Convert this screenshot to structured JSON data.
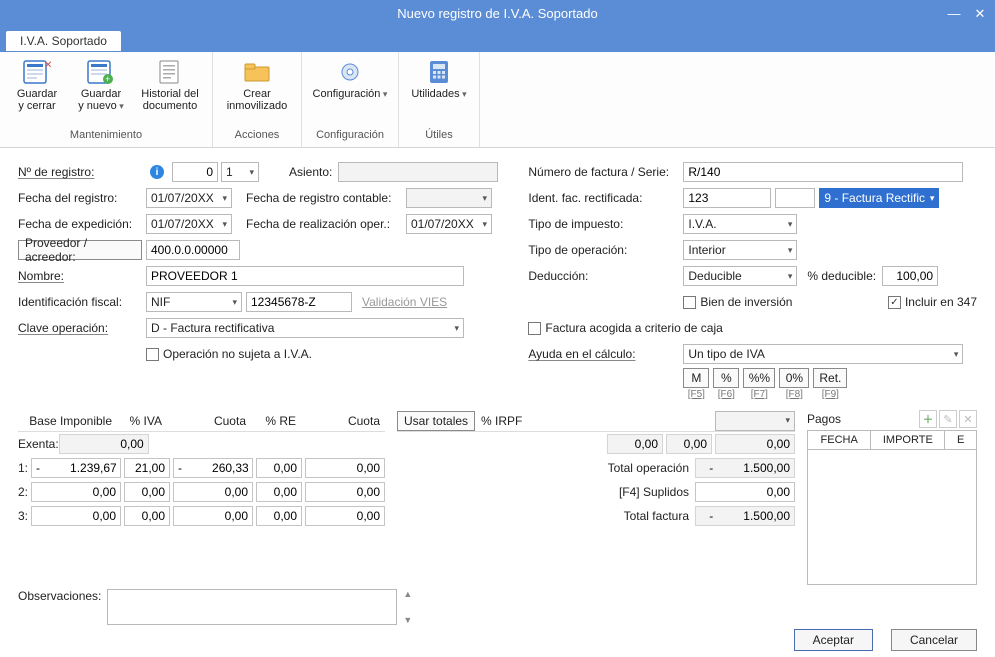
{
  "window": {
    "title": "Nuevo registro de I.V.A. Soportado"
  },
  "tab": {
    "active": "I.V.A. Soportado"
  },
  "ribbon": {
    "groups": {
      "mantenimiento": {
        "label": "Mantenimiento",
        "guardar_cerrar": "Guardar\ny cerrar",
        "guardar_nuevo": "Guardar\ny nuevo",
        "historial": "Historial del\ndocumento"
      },
      "acciones": {
        "label": "Acciones",
        "crear_inmovilizado": "Crear\ninmovilizado"
      },
      "configuracion": {
        "label": "Configuración",
        "configuracion": "Configuración"
      },
      "utiles": {
        "label": "Útiles",
        "utilidades": "Utilidades"
      }
    }
  },
  "left": {
    "n_registro_lbl": "Nº de registro:",
    "n_registro": "0",
    "n_registro_ser": "1",
    "fecha_registro_lbl": "Fecha del registro:",
    "fecha_registro": "01/07/20XX",
    "fecha_expedicion_lbl": "Fecha de expedición:",
    "fecha_expedicion": "01/07/20XX",
    "proveedor_lbl": "Proveedor / acreedor:",
    "proveedor": "400.0.0.00000",
    "nombre_lbl": "Nombre:",
    "nombre": "PROVEEDOR 1",
    "ident_fiscal_lbl": "Identificación fiscal:",
    "ident_tipo": "NIF",
    "ident_valor": "12345678-Z",
    "validacion_vies": "Validación VIES",
    "clave_op_lbl": "Clave operación:",
    "clave_op": "D - Factura rectificativa",
    "no_sujeta_iva": "Operación no sujeta a I.V.A.",
    "asiento_lbl": "Asiento:",
    "fecha_reg_contable_lbl": "Fecha de registro contable:",
    "fecha_realizacion_lbl": "Fecha de realización oper.:",
    "fecha_realizacion": "01/07/20XX"
  },
  "right": {
    "num_factura_lbl": "Número de factura / Serie:",
    "num_factura": "R/140",
    "ident_rect_lbl": "Ident. fac. rectificada:",
    "ident_rect": "123",
    "ident_rect_tipo": "9 - Factura Rectific",
    "tipo_impuesto_lbl": "Tipo de impuesto:",
    "tipo_impuesto": "I.V.A.",
    "tipo_operacion_lbl": "Tipo de operación:",
    "tipo_operacion": "Interior",
    "deduccion_lbl": "Deducción:",
    "deduccion": "Deducible",
    "pct_deducible_lbl": "% deducible:",
    "pct_deducible": "100,00",
    "bien_inversion": "Bien de inversión",
    "incluir_347": "Incluir en 347",
    "criterio_caja": "Factura acogida a criterio de caja",
    "ayuda_calculo_lbl": "Ayuda en el cálculo:",
    "ayuda_calculo": "Un tipo de IVA",
    "btn_M": "M",
    "btn_pct": "%",
    "btn_pp": "%%",
    "btn_0": "0%",
    "btn_ret": "Ret.",
    "sub_F5": "[F5]",
    "sub_F6": "[F6]",
    "sub_F7": "[F7]",
    "sub_F8": "[F8]",
    "sub_F9": "[F9]"
  },
  "grid": {
    "headers": {
      "base": "Base Imponible",
      "pct_iva": "% IVA",
      "cuota": "Cuota",
      "pct_re": "% RE",
      "cuota2": "Cuota",
      "usar_totales": "Usar totales",
      "pct_irpf": "% IRPF"
    },
    "exenta_lbl": "Exenta:",
    "exenta": {
      "base": "0,00"
    },
    "r1_lbl": "1:",
    "r1": {
      "base": "-         1.239,67",
      "pct_iva": "21,00",
      "cuota": "-         260,33",
      "pct_re": "0,00",
      "cuota2": "0,00"
    },
    "r2_lbl": "2:",
    "r2": {
      "base": "0,00",
      "pct_iva": "0,00",
      "cuota": "0,00",
      "pct_re": "0,00",
      "cuota2": "0,00"
    },
    "r3_lbl": "3:",
    "r3": {
      "base": "0,00",
      "pct_iva": "0,00",
      "cuota": "0,00",
      "pct_re": "0,00",
      "cuota2": "0,00"
    },
    "irpf_row": {
      "a": "0,00",
      "b": "0,00",
      "c": "0,00"
    },
    "totals": {
      "total_op_lbl": "Total operación",
      "total_op": "-         1.500,00",
      "suplidos_lbl": "[F4] Suplidos",
      "suplidos": "0,00",
      "total_fac_lbl": "Total factura",
      "total_fac": "-         1.500,00"
    }
  },
  "pagos": {
    "title": "Pagos",
    "col_fecha": "FECHA",
    "col_importe": "IMPORTE",
    "col_e": "E"
  },
  "obs_lbl": "Observaciones:",
  "actions": {
    "aceptar": "Aceptar",
    "cancelar": "Cancelar"
  }
}
